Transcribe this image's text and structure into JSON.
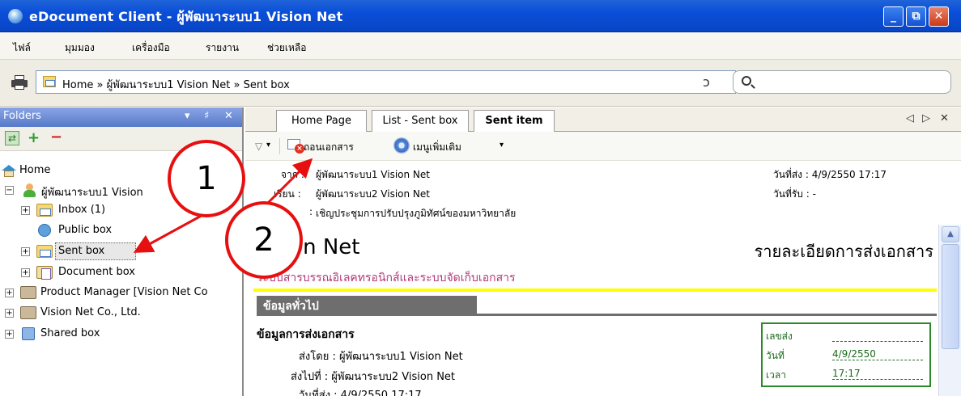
{
  "window": {
    "title": "eDocument Client - ผู้พัฒนาระบบ1 Vision Net",
    "min_glyph": "_",
    "max_glyph": "⧉",
    "close_glyph": "✕"
  },
  "menu": [
    "ไฟล์",
    "มุมมอง",
    "เครื่องมือ",
    "รายงาน",
    "ช่วยเหลือ"
  ],
  "address": {
    "path": "Home » ผู้พัฒนาระบบ1 Vision Net » Sent box",
    "refresh_glyph": "ↄ",
    "search_value": ""
  },
  "folders": {
    "title": "Folders",
    "head_controls": [
      "▾",
      "♯",
      "✕"
    ],
    "tool_glyphs": {
      "refresh": "⇄",
      "add": "+",
      "remove": "−"
    },
    "tree": {
      "home": "Home",
      "user": "ผู้พัฒนาระบบ1 Vision",
      "inbox": "Inbox (1)",
      "public": "Public box",
      "sent": "Sent box",
      "document": "Document box",
      "product": "Product Manager [Vision Net Co",
      "company": "Vision Net Co., Ltd.",
      "shared": "Shared box"
    },
    "selected": "Sent box"
  },
  "tabs": {
    "items": [
      "Home Page",
      "List - Sent box",
      "Sent item"
    ],
    "active": "Sent item",
    "nav": [
      "◁",
      "▷",
      "✕"
    ]
  },
  "actions": {
    "filter_glyph": "▽",
    "drop_glyph": "▾",
    "recall_label": "ถอนเอกสาร",
    "more_label": "เมนูเพิ่มเติม"
  },
  "message": {
    "from_label": "จาก :",
    "from_value": "ผู้พัฒนาระบบ1 Vision Net",
    "to_label": "เรียน :",
    "to_value": "ผู้พัฒนาระบบ2 Vision Net",
    "subject_label": ":",
    "subject_value": "เชิญประชุมการปรับปรุงภูมิทัศน์ของมหาวิทยาลัย",
    "sent_date": "วันที่ส่ง : 4/9/2550 17:17",
    "received_date": "วันที่รับ : -"
  },
  "document": {
    "company": "Vision Net",
    "heading": "รายละเอียดการส่งเอกสาร",
    "subtitle": "ระบบสารบรรณอิเลคทรอนิกส์และระบบจัดเก็บเอกสาร",
    "section": "ข้อมูลทั่วไป",
    "subheading": "ข้อมูลการส่งเอกสาร",
    "sent_by": "ส่งโดย : ผู้พัฒนาระบบ1 Vision Net",
    "sent_to": "ส่งไปที่ : ผู้พัฒนาระบบ2 Vision Net",
    "sent_on": "วันที่ส่ง : 4/9/2550 17:17",
    "box": {
      "number_label": "เลขส่ง",
      "number_value": "",
      "date_label": "วันที่",
      "date_value": "4/9/2550",
      "time_label": "เวลา",
      "time_value": "17:17"
    }
  },
  "callouts": [
    "1",
    "2"
  ],
  "colors": {
    "title_bar": "#0a4ed8",
    "callout": "#e61010",
    "highlight_rule": "#ffff00",
    "section_bar": "#6e6e6e",
    "doc_box_border": "#2a8a2a"
  }
}
